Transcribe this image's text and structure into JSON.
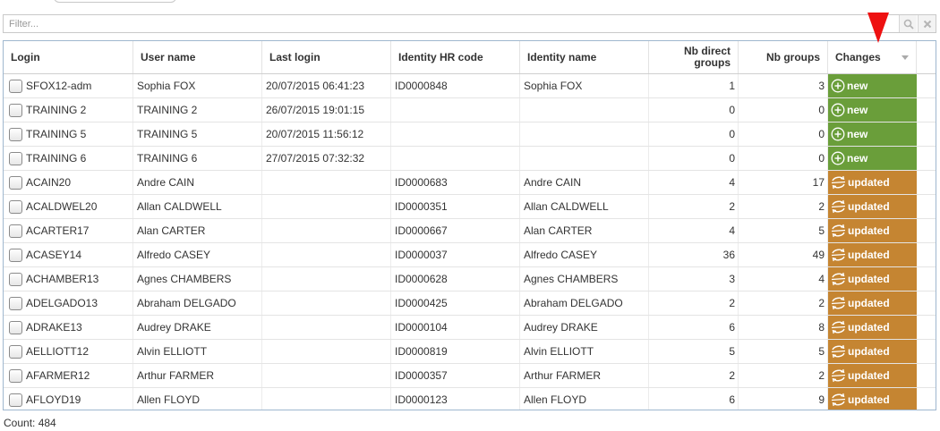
{
  "filter": {
    "placeholder": "Filter..."
  },
  "colors": {
    "new": "#6a9e3a",
    "updated": "#c58532",
    "arrow": "#ee1111"
  },
  "columns": [
    {
      "label": "Login",
      "align": "left"
    },
    {
      "label": "User name",
      "align": "left"
    },
    {
      "label": "Last login",
      "align": "left"
    },
    {
      "label": "Identity HR code",
      "align": "left"
    },
    {
      "label": "Identity name",
      "align": "left"
    },
    {
      "label": "Nb direct groups",
      "align": "right"
    },
    {
      "label": "Nb groups",
      "align": "right"
    },
    {
      "label": "Changes",
      "align": "left"
    }
  ],
  "rows": [
    {
      "login": "SFOX12-adm",
      "user": "Sophia FOX",
      "last": "20/07/2015 06:41:23",
      "hr": "ID0000848",
      "identity": "Sophia FOX",
      "direct": "1",
      "groups": "3",
      "change": "new"
    },
    {
      "login": "TRAINING 2",
      "user": "TRAINING 2",
      "last": "26/07/2015 19:01:15",
      "hr": "",
      "identity": "",
      "direct": "0",
      "groups": "0",
      "change": "new"
    },
    {
      "login": "TRAINING 5",
      "user": "TRAINING 5",
      "last": "20/07/2015 11:56:12",
      "hr": "",
      "identity": "",
      "direct": "0",
      "groups": "0",
      "change": "new"
    },
    {
      "login": "TRAINING 6",
      "user": "TRAINING 6",
      "last": "27/07/2015 07:32:32",
      "hr": "",
      "identity": "",
      "direct": "0",
      "groups": "0",
      "change": "new"
    },
    {
      "login": "ACAIN20",
      "user": "Andre CAIN",
      "last": "",
      "hr": "ID0000683",
      "identity": "Andre CAIN",
      "direct": "4",
      "groups": "17",
      "change": "updated"
    },
    {
      "login": "ACALDWEL20",
      "user": "Allan CALDWELL",
      "last": "",
      "hr": "ID0000351",
      "identity": "Allan CALDWELL",
      "direct": "2",
      "groups": "2",
      "change": "updated"
    },
    {
      "login": "ACARTER17",
      "user": "Alan CARTER",
      "last": "",
      "hr": "ID0000667",
      "identity": "Alan CARTER",
      "direct": "4",
      "groups": "5",
      "change": "updated"
    },
    {
      "login": "ACASEY14",
      "user": "Alfredo CASEY",
      "last": "",
      "hr": "ID0000037",
      "identity": "Alfredo CASEY",
      "direct": "36",
      "groups": "49",
      "change": "updated"
    },
    {
      "login": "ACHAMBER13",
      "user": "Agnes CHAMBERS",
      "last": "",
      "hr": "ID0000628",
      "identity": "Agnes CHAMBERS",
      "direct": "3",
      "groups": "4",
      "change": "updated"
    },
    {
      "login": "ADELGADO13",
      "user": "Abraham DELGADO",
      "last": "",
      "hr": "ID0000425",
      "identity": "Abraham DELGADO",
      "direct": "2",
      "groups": "2",
      "change": "updated"
    },
    {
      "login": "ADRAKE13",
      "user": "Audrey DRAKE",
      "last": "",
      "hr": "ID0000104",
      "identity": "Audrey DRAKE",
      "direct": "6",
      "groups": "8",
      "change": "updated"
    },
    {
      "login": "AELLIOTT12",
      "user": "Alvin ELLIOTT",
      "last": "",
      "hr": "ID0000819",
      "identity": "Alvin ELLIOTT",
      "direct": "5",
      "groups": "5",
      "change": "updated"
    },
    {
      "login": "AFARMER12",
      "user": "Arthur FARMER",
      "last": "",
      "hr": "ID0000357",
      "identity": "Arthur FARMER",
      "direct": "2",
      "groups": "2",
      "change": "updated"
    },
    {
      "login": "AFLOYD19",
      "user": "Allen FLOYD",
      "last": "",
      "hr": "ID0000123",
      "identity": "Allen FLOYD",
      "direct": "6",
      "groups": "9",
      "change": "updated"
    }
  ],
  "footer": {
    "count": "Count: 484"
  }
}
